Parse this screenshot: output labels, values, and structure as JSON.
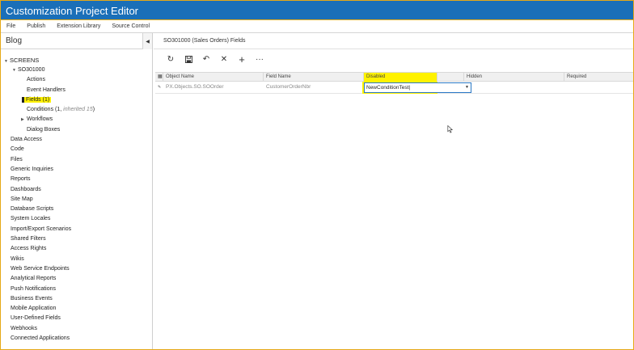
{
  "window": {
    "title": "Customization Project Editor"
  },
  "menu": [
    "File",
    "Publish",
    "Extension Library",
    "Source Control"
  ],
  "sidebar": {
    "project": "Blog",
    "screens_label": "SCREENS",
    "screen_id": "SO301000",
    "screen_children": [
      {
        "label": "Actions"
      },
      {
        "label": "Event Handlers"
      },
      {
        "label": "Fields (1)",
        "highlighted": true
      },
      {
        "label": "Conditions (1, ",
        "inherited": "inherited 15",
        "suffix": ")"
      },
      {
        "label": "Workflows",
        "expandable": true
      },
      {
        "label": "Dialog Boxes"
      }
    ],
    "items": [
      "Data Access",
      "Code",
      "Files",
      "Generic Inquiries",
      "Reports",
      "Dashboards",
      "Site Map",
      "Database Scripts",
      "System Locales",
      "Import/Export Scenarios",
      "Shared Filters",
      "Access Rights",
      "Wikis",
      "Web Service Endpoints",
      "Analytical Reports",
      "Push Notifications",
      "Business Events",
      "Mobile Application",
      "User-Defined Fields",
      "Webhooks",
      "Connected Applications"
    ]
  },
  "main": {
    "heading": "SO301000 (Sales Orders) Fields",
    "toolbar": [
      {
        "name": "refresh-icon",
        "glyph": "↻"
      },
      {
        "name": "save-icon",
        "glyph": "💾"
      },
      {
        "name": "undo-icon",
        "glyph": "↶"
      },
      {
        "name": "delete-icon",
        "glyph": "✕"
      },
      {
        "name": "add-icon",
        "glyph": "+"
      },
      {
        "name": "more-icon",
        "glyph": "···"
      }
    ],
    "grid": {
      "columns": [
        "Object Name",
        "Field Name",
        "Disabled",
        "Hidden",
        "Required"
      ],
      "rows": [
        {
          "object": "PX.Objects.SO.SOOrder",
          "field": "CustomerOrderNbr",
          "disabled": "NewConditionTest|",
          "hidden": "",
          "required": ""
        }
      ]
    }
  },
  "colors": {
    "title_bg": "#1a6fb8",
    "highlight": "#fff200",
    "focus_border": "#2a78c6"
  }
}
